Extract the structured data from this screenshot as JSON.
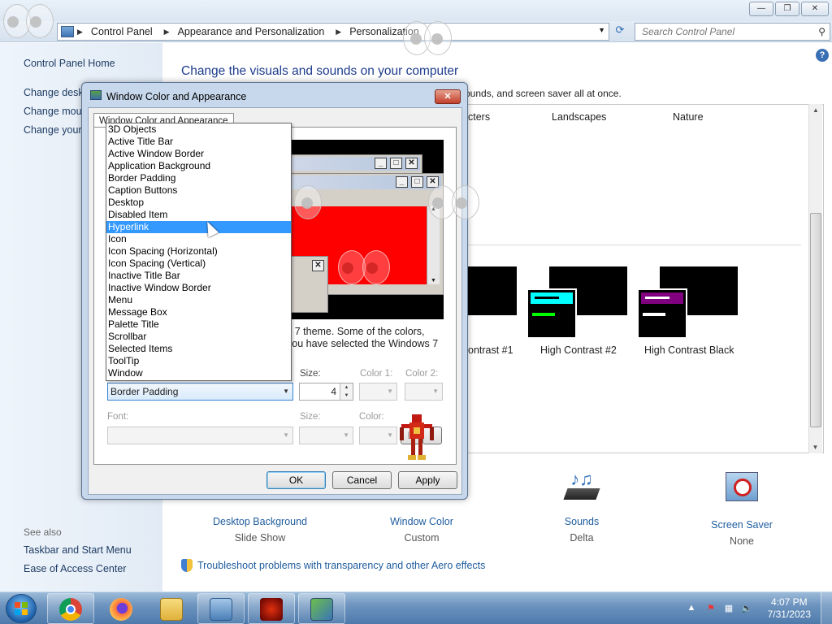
{
  "window": {
    "controls": [
      "—",
      "❐",
      "✕"
    ],
    "breadcrumb": [
      "Control Panel",
      "Appearance and Personalization",
      "Personalization"
    ],
    "search_placeholder": "Search Control Panel"
  },
  "leftpane": {
    "home": "Control Panel Home",
    "links": [
      "Change deskt",
      "Change mous",
      "Change your"
    ],
    "see_also": "See also",
    "see_also_links": [
      "Taskbar and Start Menu",
      "Ease of Access Center"
    ]
  },
  "main": {
    "title": "Change the visuals and sounds on your computer",
    "subtitle": "ounds, and screen saver all at once.",
    "theme_labels": [
      "cters",
      "Landscapes",
      "Nature"
    ],
    "hc_labels": [
      "ontrast #1",
      "High Contrast #2",
      "High Contrast Black"
    ],
    "bottom_items": [
      {
        "link": "Desktop Background",
        "sub": "Slide Show"
      },
      {
        "link": "Window Color",
        "sub": "Custom"
      },
      {
        "link": "Sounds",
        "sub": "Delta"
      },
      {
        "link": "Screen Saver",
        "sub": "None"
      }
    ],
    "troubleshoot": "Troubleshoot problems with transparency and other Aero effects",
    "help": "?"
  },
  "dialog": {
    "title": "Window Color and Appearance",
    "tab": "Window Color and Appearance",
    "close": "✕",
    "text_line1": "s 7 theme.  Some of the colors,",
    "text_line2": "you have selected the Windows 7",
    "item_selected": "Border Padding",
    "size_label": "Size:",
    "size_value": "4",
    "color1_label": "Color 1:",
    "color2_label": "Color 2:",
    "font_label": "Font:",
    "font_size_label": "Size:",
    "font_color_label": "Color:",
    "ok": "OK",
    "cancel": "Cancel",
    "apply": "Apply",
    "dropdown_items": [
      "3D Objects",
      "Active Title Bar",
      "Active Window Border",
      "Application Background",
      "Border Padding",
      "Caption Buttons",
      "Desktop",
      "Disabled Item",
      "Hyperlink",
      "Icon",
      "Icon Spacing (Horizontal)",
      "Icon Spacing (Vertical)",
      "Inactive Title Bar",
      "Inactive Window Border",
      "Menu",
      "Message Box",
      "Palette Title",
      "Scrollbar",
      "Selected Items",
      "ToolTip",
      "Window"
    ],
    "highlighted_index": 8
  },
  "taskbar": {
    "time": "4:07 PM",
    "date": "7/31/2023",
    "apps": [
      "chrome-icon",
      "firefox-icon",
      "file-explorer-icon",
      "control-panel-icon",
      "bionicle-game-icon",
      "personalization-icon"
    ]
  },
  "colors": {
    "accent_link": "#1e5c9e",
    "selection": "#3399ff",
    "preview_red": "#ff0000"
  }
}
